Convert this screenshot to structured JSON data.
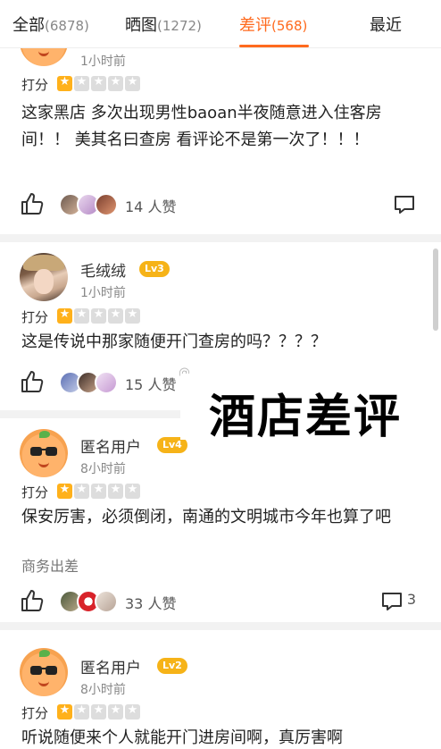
{
  "tabs": [
    {
      "label": "全部",
      "count": "(6878)"
    },
    {
      "label": "晒图",
      "count": "(1272)"
    },
    {
      "label": "差评",
      "count": "(568)"
    },
    {
      "label": "最近",
      "count": ""
    }
  ],
  "active_tab": "差评",
  "rating_label": "打分",
  "reviews": [
    {
      "username": "",
      "level": "",
      "time": "1小时前",
      "stars": 1,
      "text": "这家黑店 多次出现男性baoan半夜随意进入住客房间！！ 美其名曰查房 看评论不是第一次了！！！",
      "likes": "14 人赞",
      "comments": ""
    },
    {
      "username": "毛绒绒",
      "level": "Lv3",
      "time": "1小时前",
      "stars": 1,
      "text": "这是传说中那家随便开门查房的吗？？？？",
      "likes": "15 人赞",
      "comments": ""
    },
    {
      "username": "匿名用户",
      "level": "Lv4",
      "time": "8小时前",
      "stars": 1,
      "text": "保安厉害，必须倒闭，南通的文明城市今年也算了吧",
      "tag": "商务出差",
      "likes": "33 人赞",
      "comments": "3"
    },
    {
      "username": "匿名用户",
      "level": "Lv2",
      "time": "8小时前",
      "stars": 1,
      "text": "听说随便来个人就能开门进房间啊，真厉害啊",
      "likes": "",
      "comments": ""
    }
  ],
  "overlay_caption": "酒店差评",
  "watermark": "@",
  "colors": {
    "accent": "#ff6a1e",
    "star_on": "#ffb11b",
    "star_off": "#dddddd",
    "level_badge": "#f6b318"
  },
  "icons": [
    "thumbs-up-icon",
    "comment-icon",
    "star-icon"
  ]
}
